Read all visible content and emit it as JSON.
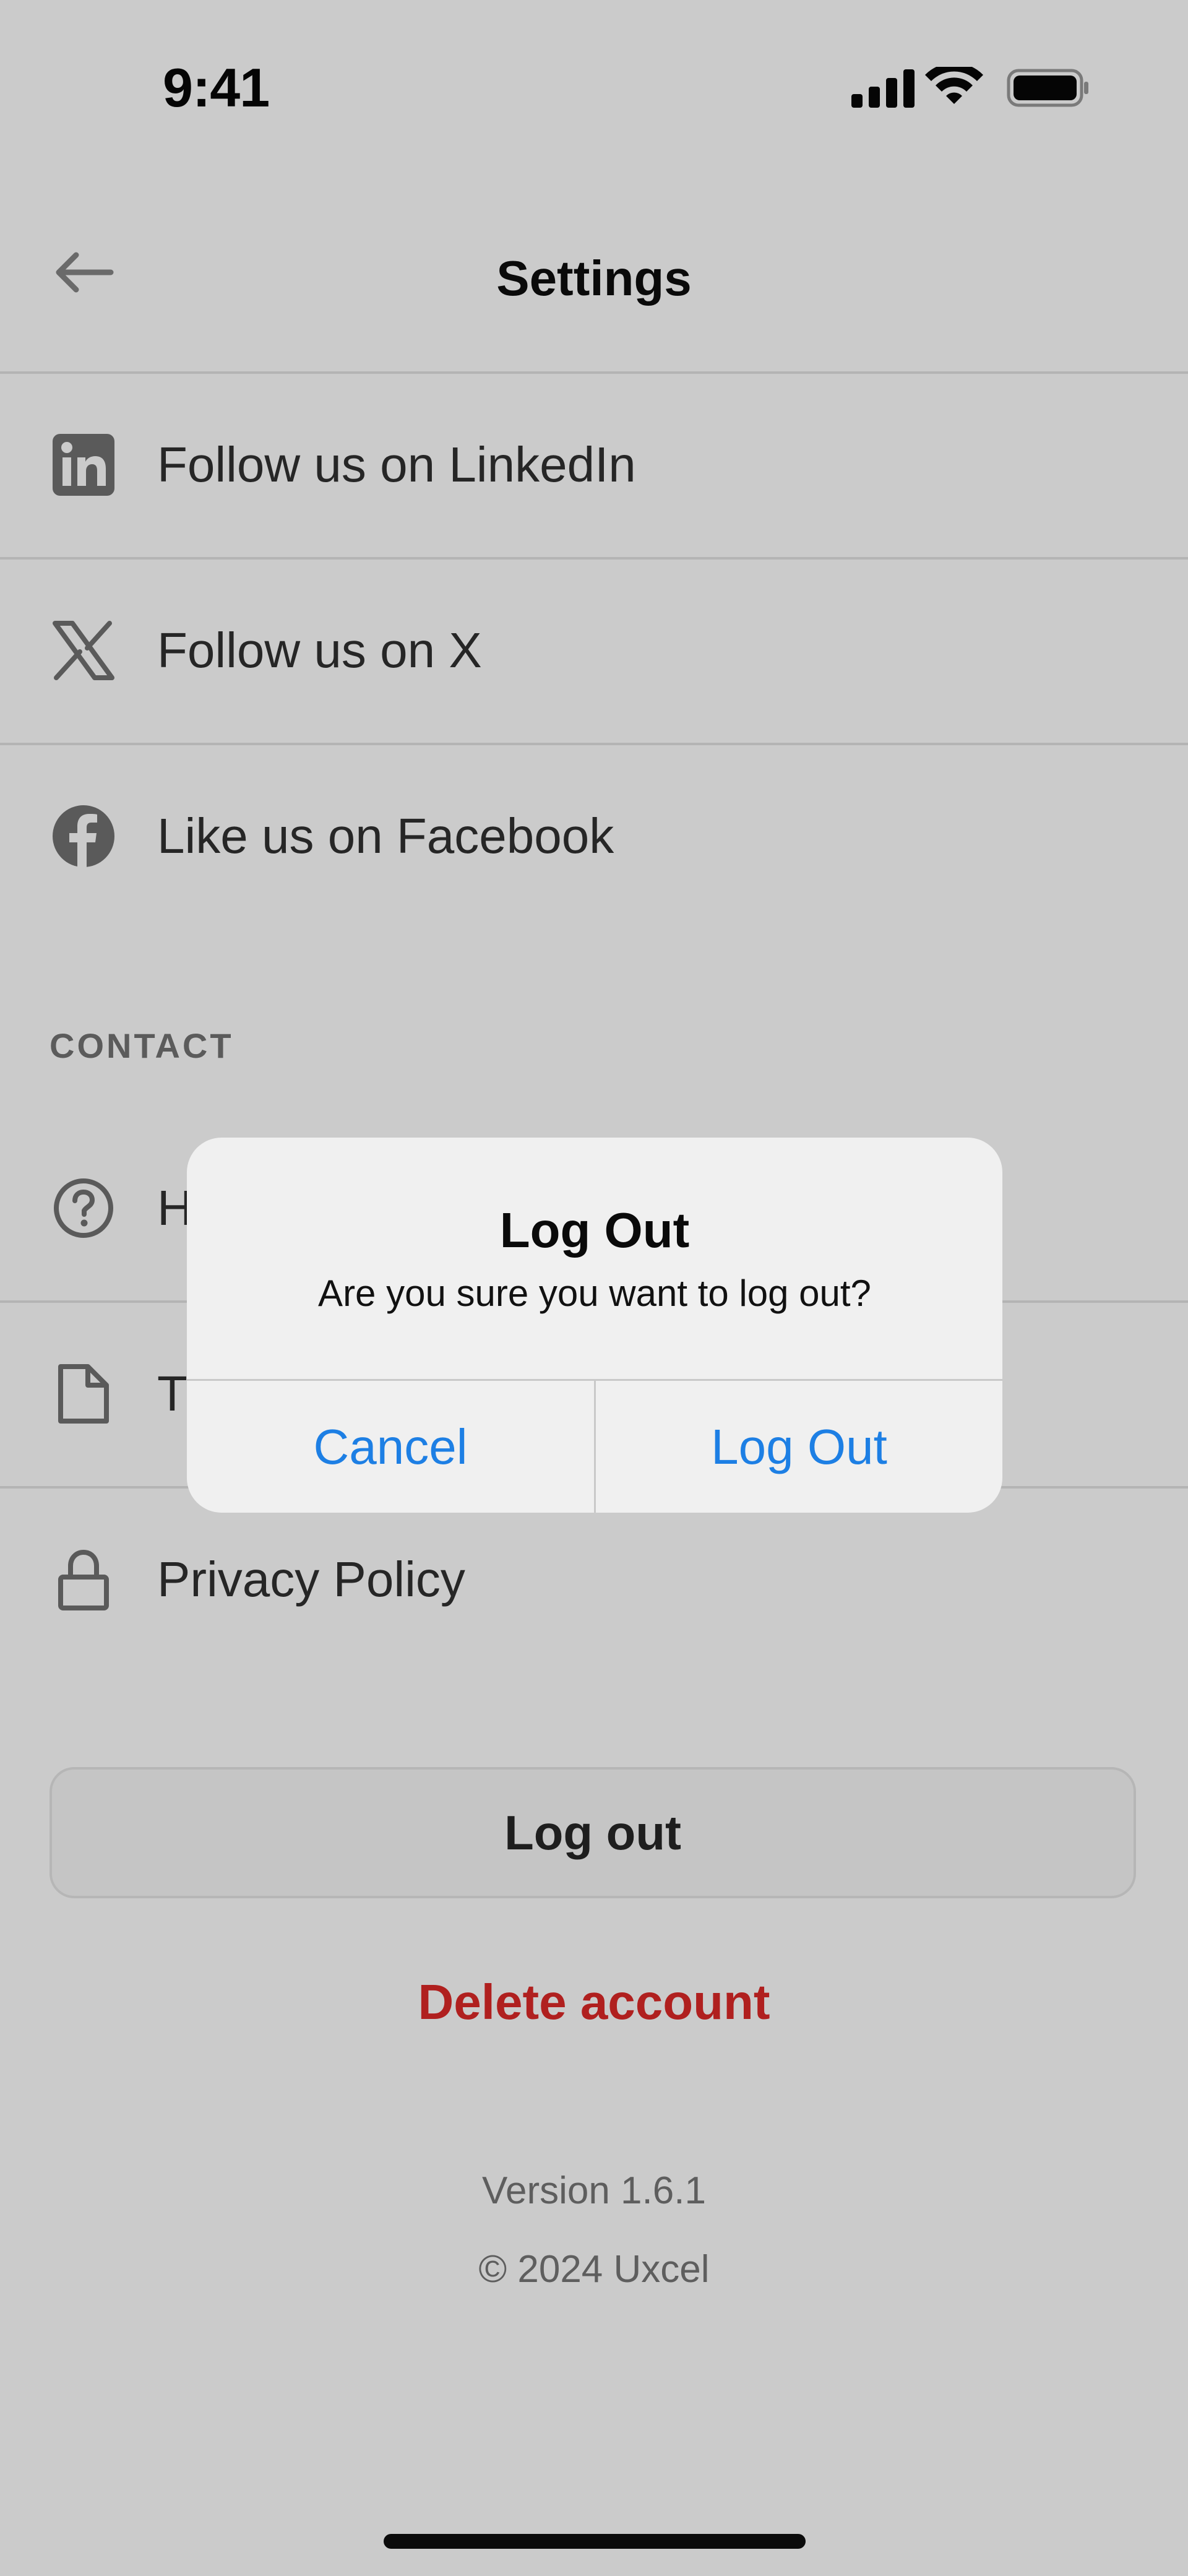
{
  "status_bar": {
    "time": "9:41",
    "icons": [
      "cellular-signal-icon",
      "wifi-icon",
      "battery-icon"
    ]
  },
  "header": {
    "title": "Settings",
    "back_icon": "arrow-left-icon"
  },
  "social_items": [
    {
      "label": "Follow us on LinkedIn",
      "icon": "linkedin-icon"
    },
    {
      "label": "Follow us on X",
      "icon": "x-logo-icon"
    },
    {
      "label": "Like us on Facebook",
      "icon": "facebook-icon"
    }
  ],
  "contact_section": {
    "header": "CONTACT",
    "items": [
      {
        "label": "H",
        "icon": "help-circle-icon"
      },
      {
        "label": "T",
        "icon": "document-icon"
      },
      {
        "label": "Privacy Policy",
        "icon": "lock-icon"
      }
    ]
  },
  "actions": {
    "logout_label": "Log out",
    "delete_label": "Delete account"
  },
  "footer": {
    "version": "Version 1.6.1",
    "copyright": "© 2024 Uxcel"
  },
  "dialog": {
    "title": "Log Out",
    "message": "Are you sure you want to log out?",
    "cancel_label": "Cancel",
    "confirm_label": "Log Out"
  },
  "colors": {
    "background": "#cbcbcb",
    "accent_blue": "#1d7fe4",
    "destructive_red": "#b0201f",
    "dialog_background": "#f0f0f0"
  }
}
